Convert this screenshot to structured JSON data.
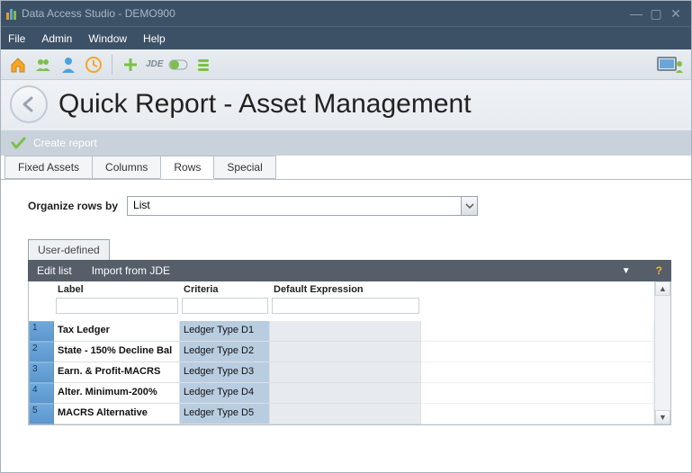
{
  "window": {
    "title": "Data Access Studio - DEMO900"
  },
  "menu": {
    "file": "File",
    "admin": "Admin",
    "window": "Window",
    "help": "Help"
  },
  "header": {
    "page_title": "Quick Report - Asset Management"
  },
  "substep": {
    "label": "Create report"
  },
  "tabs": {
    "items": [
      {
        "label": "Fixed Assets",
        "active": false
      },
      {
        "label": "Columns",
        "active": false
      },
      {
        "label": "Rows",
        "active": true
      },
      {
        "label": "Special",
        "active": false
      }
    ]
  },
  "organize": {
    "label": "Organize rows by",
    "value": "List"
  },
  "subtabs": {
    "user_defined": "User-defined"
  },
  "darkbar": {
    "edit_list": "Edit list",
    "import_jde": "Import from JDE"
  },
  "grid": {
    "headers": {
      "label": "Label",
      "criteria": "Criteria",
      "defexp": "Default Expression"
    },
    "rows": [
      {
        "n": "1",
        "label": "Tax Ledger",
        "criteria": "Ledger Type D1"
      },
      {
        "n": "2",
        "label": "State - 150% Decline Bal",
        "criteria": "Ledger Type D2"
      },
      {
        "n": "3",
        "label": "Earn. & Profit-MACRS",
        "criteria": "Ledger Type D3"
      },
      {
        "n": "4",
        "label": "Alter. Minimum-200%",
        "criteria": "Ledger Type D4"
      },
      {
        "n": "5",
        "label": "MACRS Alternative",
        "criteria": "Ledger Type D5"
      }
    ]
  }
}
